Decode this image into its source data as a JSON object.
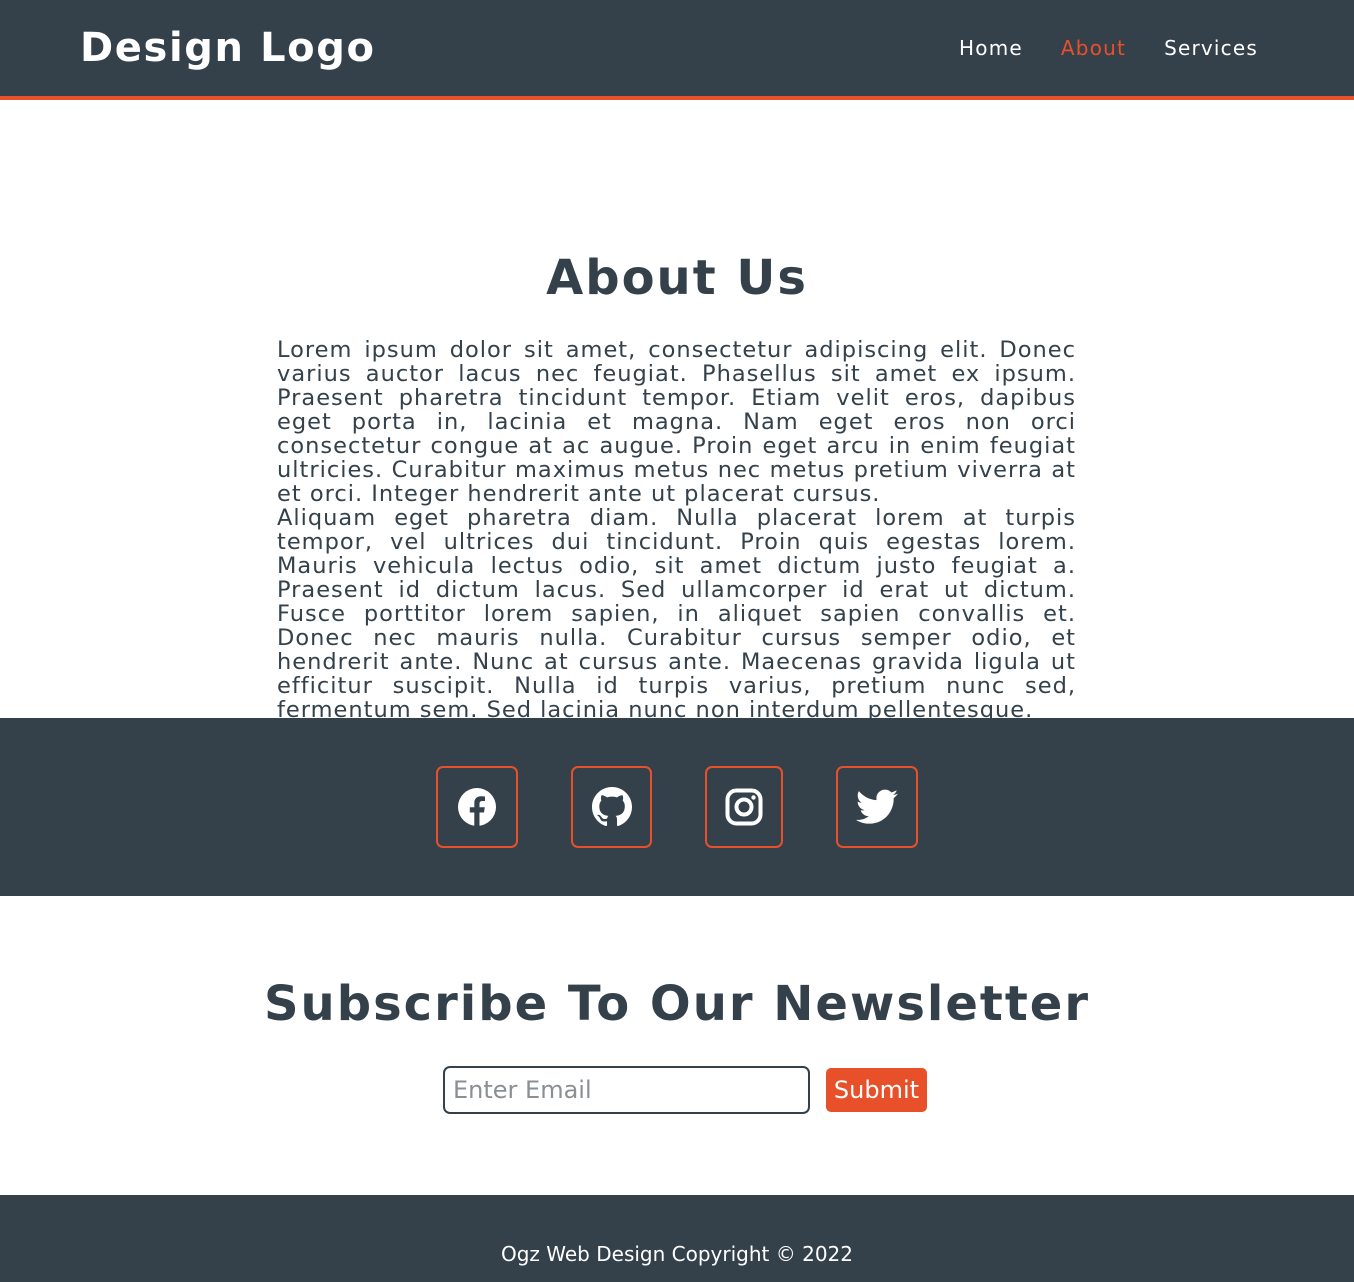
{
  "header": {
    "logo": "Design Logo",
    "nav": [
      {
        "label": "Home",
        "active": false
      },
      {
        "label": "About",
        "active": true
      },
      {
        "label": "Services",
        "active": false
      }
    ]
  },
  "about": {
    "title": "About Us",
    "paragraphs": [
      "Lorem ipsum dolor sit amet, consectetur adipiscing elit. Donec varius auctor lacus nec feugiat. Phasellus sit amet ex ipsum. Praesent pharetra tincidunt tempor. Etiam velit eros, dapibus eget porta in, lacinia et magna. Nam eget eros non orci consectetur congue at ac augue. Proin eget arcu in enim feugiat ultricies. Curabitur maximus metus nec metus pretium viverra at et orci. Integer hendrerit ante ut placerat cursus.",
      "Aliquam eget pharetra diam. Nulla placerat lorem at turpis tempor, vel ultrices dui tincidunt. Proin quis egestas lorem. Mauris vehicula lectus odio, sit amet dictum justo feugiat a. Praesent id dictum lacus. Sed ullamcorper id erat ut dictum. Fusce porttitor lorem sapien, in aliquet sapien convallis et. Donec nec mauris nulla. Curabitur cursus semper odio, et hendrerit ante. Nunc at cursus ante. Maecenas gravida ligula ut efficitur suscipit. Nulla id turpis varius, pretium nunc sed, fermentum sem. Sed lacinia nunc non interdum pellentesque."
    ]
  },
  "social": {
    "icons": [
      "facebook-icon",
      "github-icon",
      "instagram-icon",
      "twitter-icon"
    ]
  },
  "newsletter": {
    "title": "Subscribe To Our Newsletter",
    "email_placeholder": "Enter Email",
    "email_value": "",
    "submit_label": "Submit"
  },
  "footer": {
    "copyright": "Ogz Web Design Copyright © 2022"
  },
  "colors": {
    "dark": "#34414b",
    "accent": "#e8502a",
    "text_light": "#ffffff"
  }
}
